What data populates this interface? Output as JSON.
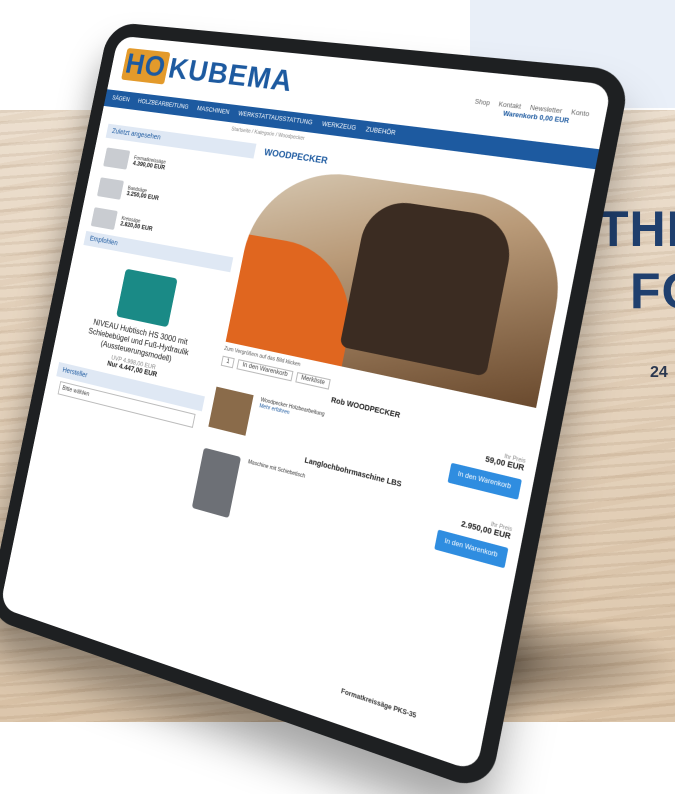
{
  "ad": {
    "headline_line1": "THE",
    "headline_line2": "FO",
    "sub": "24"
  },
  "site": {
    "logo_prefix": "HO",
    "logo_suffix": "KUBEMA",
    "top_links": [
      "Shop",
      "Kontakt",
      "Newsletter",
      "Konto"
    ],
    "cart_label": "Warenkorb",
    "cart_value": "0,00 EUR",
    "nav": [
      "Sägen",
      "Holzbearbeitung",
      "Maschinen",
      "Werkstattausstattung",
      "Werkzeug",
      "Zubehör"
    ],
    "breadcrumb": "Startseite / Kategorie / Woodpecker",
    "sidebar": {
      "recently_label": "Zuletzt angesehen",
      "items": [
        {
          "text": "Formatkreissäge",
          "price": "4.390,00 EUR"
        },
        {
          "text": "Bandsäge",
          "price": "3.250,00 EUR"
        },
        {
          "text": "Kreissäge",
          "price": "2.820,00 EUR"
        }
      ],
      "recommended_label": "Empfohlen",
      "recommended_title": "NIVEAU Hubtisch HS 3000 mit Schiebebügel und Fuß-Hydraulik (Aussteuerungsmodell)",
      "recommended_old": "UVP 4.998,00 EUR",
      "recommended_price": "Nur 4.447,00 EUR",
      "manufacturer_label": "Hersteller",
      "manufacturer_select": "Bitte wählen"
    },
    "main": {
      "title": "WOODPECKER",
      "caption": "Zum Vergrößern auf das Bild klicken",
      "qty": [
        "1",
        "In den Warenkorb",
        "Merkliste"
      ],
      "section1_title": "Rob WOODPECKER",
      "section1_text": "Woodpecker Holzbearbeitung",
      "section1_link": "Mehr erfahren",
      "section1_price_label": "Ihr Preis",
      "section1_price": "59,00 EUR",
      "section1_button": "In den Warenkorb",
      "section2_title": "Langlochbohrmaschine LBS",
      "section2_text": "Maschine mit Schiebetisch",
      "section2_price_label": "Ihr Preis",
      "section2_price": "2.950,00 EUR",
      "section2_button": "In den Warenkorb",
      "footer_tag": "Formatkreissäge PKS-35"
    }
  }
}
